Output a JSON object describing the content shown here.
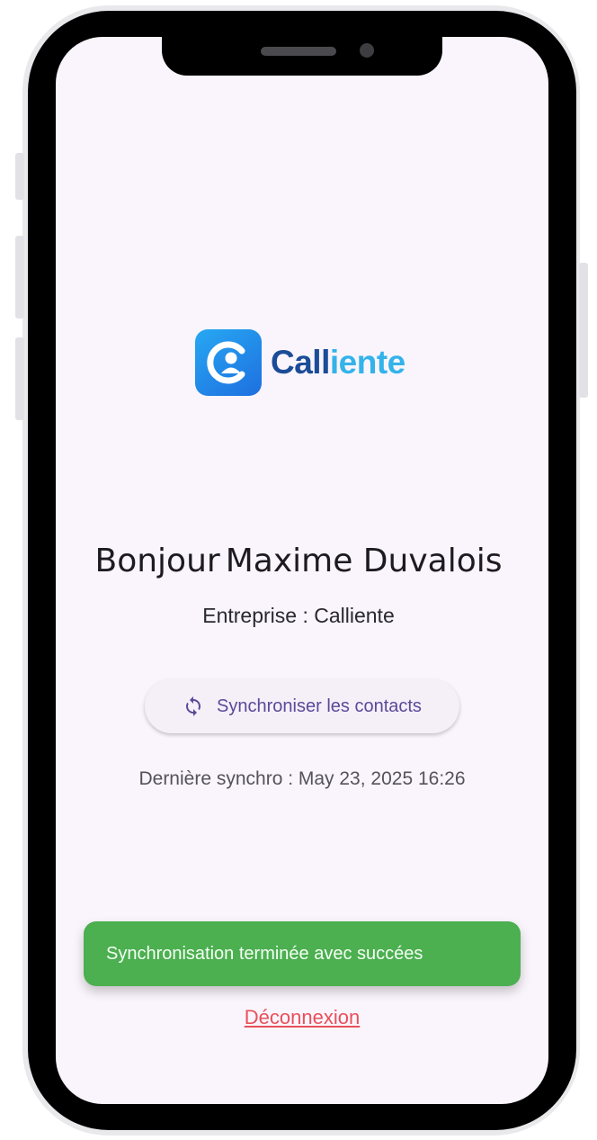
{
  "brand": {
    "name_part1": "Call",
    "name_part2": "iente",
    "colors": {
      "primary": "#1b4c97",
      "accent": "#33b3ea",
      "icon_bg": "#1e6fe0"
    },
    "icon": "calliente-logo-icon"
  },
  "greeting": {
    "hello": "Bonjour",
    "user_name": "Maxime Duvalois"
  },
  "company": {
    "text": "Entreprise : Calliente"
  },
  "sync_button": {
    "label": "Synchroniser les contacts",
    "icon": "sync-icon"
  },
  "last_sync": {
    "text": "Dernière synchro : May 23, 2025 16:26"
  },
  "snackbar": {
    "message": "Synchronisation terminée avec succées",
    "color": "#4caf50"
  },
  "logout": {
    "label": "Déconnexion",
    "color": "#e8505b"
  }
}
